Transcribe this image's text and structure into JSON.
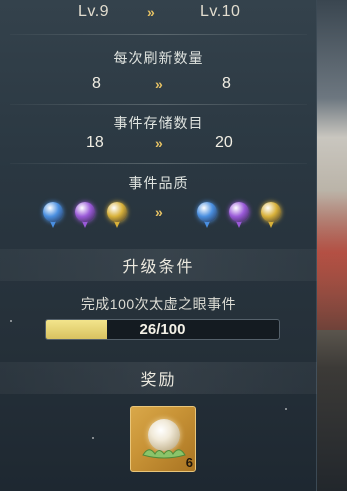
{
  "upgrade": {
    "level_from": "Lv.9",
    "level_to": "Lv.10",
    "arrow": "»"
  },
  "refresh": {
    "label": "每次刷新数量",
    "from": "8",
    "to": "8"
  },
  "storage": {
    "label": "事件存储数目",
    "from": "18",
    "to": "20"
  },
  "quality": {
    "label": "事件品质",
    "from_orbs": [
      {
        "name": "blue-orb-icon",
        "color": "#4a8fe0"
      },
      {
        "name": "purple-orb-icon",
        "color": "#9a5ad8"
      },
      {
        "name": "gold-orb-icon",
        "color": "#d8b13a"
      }
    ],
    "to_orbs": [
      {
        "name": "blue-orb-icon",
        "color": "#4a8fe0"
      },
      {
        "name": "purple-orb-icon",
        "color": "#9a5ad8"
      },
      {
        "name": "gold-orb-icon",
        "color": "#d8b13a"
      }
    ]
  },
  "requirement": {
    "header": "升级条件",
    "task": "完成100次太虚之眼事件",
    "progress_text": "26/100",
    "progress_fraction": 0.26
  },
  "reward": {
    "header": "奖励",
    "item_icon": "pearl-on-lotus-icon",
    "count": "6"
  },
  "colors": {
    "accent_gold": "#e6c264",
    "progress_fill": "#e8d475",
    "panel_bg": "#2a3741"
  }
}
